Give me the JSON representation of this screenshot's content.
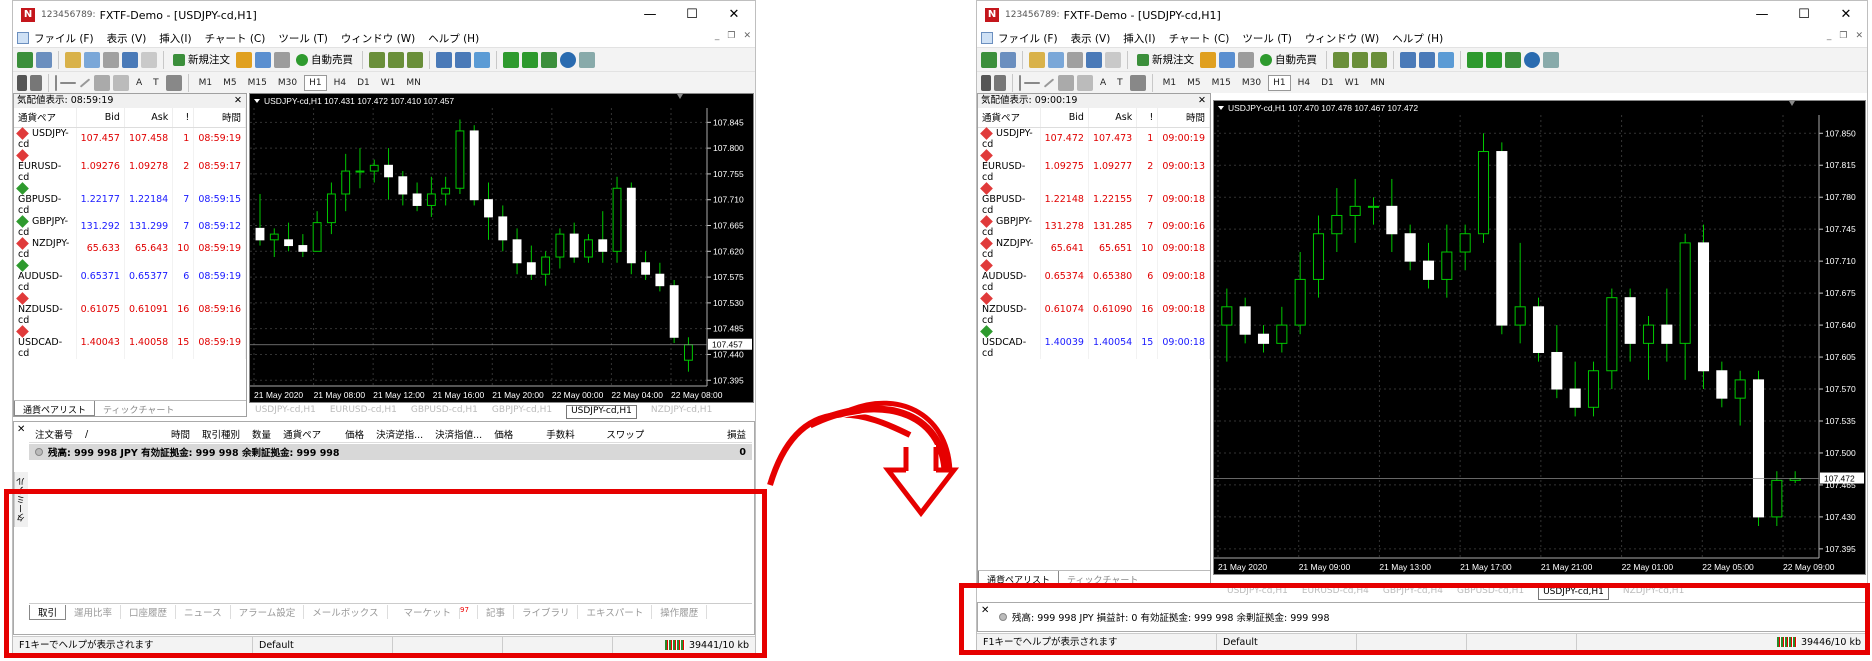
{
  "left": {
    "account": "123456789:",
    "title": "FXTF-Demo - [USDJPY-cd,H1]",
    "menus": [
      "ファイル (F)",
      "表示 (V)",
      "挿入(I)",
      "チャート (C)",
      "ツール (T)",
      "ウィンドウ (W)",
      "ヘルプ (H)"
    ],
    "toolbar": {
      "new_order": "新規注文",
      "auto_trade": "自動売買"
    },
    "timeframes": [
      "M1",
      "M5",
      "M15",
      "M30",
      "H1",
      "H4",
      "D1",
      "W1",
      "MN"
    ],
    "active_timeframe": "H1",
    "market_watch": {
      "title": "気配値表示: 08:59:19",
      "headers": [
        "通貨ペア",
        "Bid",
        "Ask",
        "!",
        "時間"
      ],
      "rows": [
        {
          "sym": "USDJPY-cd",
          "bid": "107.457",
          "ask": "107.458",
          "spread": "1",
          "time": "08:59:19",
          "dir": "down"
        },
        {
          "sym": "EURUSD-cd",
          "bid": "1.09276",
          "ask": "1.09278",
          "spread": "2",
          "time": "08:59:17",
          "dir": "down"
        },
        {
          "sym": "GBPUSD-cd",
          "bid": "1.22177",
          "ask": "1.22184",
          "spread": "7",
          "time": "08:59:15",
          "dir": "up"
        },
        {
          "sym": "GBPJPY-cd",
          "bid": "131.292",
          "ask": "131.299",
          "spread": "7",
          "time": "08:59:12",
          "dir": "up"
        },
        {
          "sym": "NZDJPY-cd",
          "bid": "65.633",
          "ask": "65.643",
          "spread": "10",
          "time": "08:59:19",
          "dir": "down"
        },
        {
          "sym": "AUDUSD-cd",
          "bid": "0.65371",
          "ask": "0.65377",
          "spread": "6",
          "time": "08:59:19",
          "dir": "up"
        },
        {
          "sym": "NZDUSD-cd",
          "bid": "0.61075",
          "ask": "0.61091",
          "spread": "16",
          "time": "08:59:16",
          "dir": "down"
        },
        {
          "sym": "USDCAD-cd",
          "bid": "1.40043",
          "ask": "1.40058",
          "spread": "15",
          "time": "08:59:19",
          "dir": "down"
        }
      ],
      "tabs": [
        "通貨ペアリスト",
        "ティックチャート"
      ]
    },
    "chart_header": "USDJPY-cd,H1  107.431 107.472 107.410 107.457",
    "price_labels": [
      "107.845",
      "107.800",
      "107.755",
      "107.710",
      "107.665",
      "107.620",
      "107.575",
      "107.530",
      "107.485",
      "107.440",
      "107.395"
    ],
    "current_price": "107.457",
    "time_labels": [
      "21 May 2020",
      "21 May 08:00",
      "21 May 12:00",
      "21 May 16:00",
      "21 May 20:00",
      "22 May 00:00",
      "22 May 04:00",
      "22 May 08:00"
    ],
    "chart_tabs": [
      "USDJPY-cd,H1",
      "EURUSD-cd,H1",
      "GBPUSD-cd,H1",
      "GBPJPY-cd,H1",
      "USDJPY-cd,H1",
      "NZDJPY-cd,H1"
    ],
    "terminal": {
      "side_label": "ターミナル",
      "headers": [
        "注文番号",
        "/",
        "時間",
        "取引種別",
        "数量",
        "通貨ペア",
        "価格",
        "決済逆指...",
        "決済指値...",
        "価格",
        "手数料",
        "スワップ",
        "損益"
      ],
      "balance": "残高: 999 998 JPY  有効証拠金: 999 998  余剰証拠金: 999 998",
      "balance_pl": "0",
      "tabs": [
        "取引",
        "運用比率",
        "口座履歴",
        "ニュース",
        "アラーム設定",
        "メールボックス",
        "マーケット",
        "記事",
        "ライブラリ",
        "エキスパート",
        "操作履歴"
      ],
      "market_badge": "97"
    },
    "status": {
      "help": "F1キーでヘルプが表示されます",
      "profile": "Default",
      "traffic": "39441/10 kb"
    }
  },
  "right": {
    "account": "123456789:",
    "title": "FXTF-Demo - [USDJPY-cd,H1]",
    "menus": [
      "ファイル (F)",
      "表示 (V)",
      "挿入(I)",
      "チャート (C)",
      "ツール (T)",
      "ウィンドウ (W)",
      "ヘルプ (H)"
    ],
    "toolbar": {
      "new_order": "新規注文",
      "auto_trade": "自動売買"
    },
    "timeframes": [
      "M1",
      "M5",
      "M15",
      "M30",
      "H1",
      "H4",
      "D1",
      "W1",
      "MN"
    ],
    "active_timeframe": "H1",
    "market_watch": {
      "title": "気配値表示: 09:00:19",
      "headers": [
        "通貨ペア",
        "Bid",
        "Ask",
        "!",
        "時間"
      ],
      "rows": [
        {
          "sym": "USDJPY-cd",
          "bid": "107.472",
          "ask": "107.473",
          "spread": "1",
          "time": "09:00:19",
          "dir": "down"
        },
        {
          "sym": "EURUSD-cd",
          "bid": "1.09275",
          "ask": "1.09277",
          "spread": "2",
          "time": "09:00:13",
          "dir": "down"
        },
        {
          "sym": "GBPUSD-cd",
          "bid": "1.22148",
          "ask": "1.22155",
          "spread": "7",
          "time": "09:00:18",
          "dir": "down"
        },
        {
          "sym": "GBPJPY-cd",
          "bid": "131.278",
          "ask": "131.285",
          "spread": "7",
          "time": "09:00:16",
          "dir": "down"
        },
        {
          "sym": "NZDJPY-cd",
          "bid": "65.641",
          "ask": "65.651",
          "spread": "10",
          "time": "09:00:18",
          "dir": "down"
        },
        {
          "sym": "AUDUSD-cd",
          "bid": "0.65374",
          "ask": "0.65380",
          "spread": "6",
          "time": "09:00:18",
          "dir": "down"
        },
        {
          "sym": "NZDUSD-cd",
          "bid": "0.61074",
          "ask": "0.61090",
          "spread": "16",
          "time": "09:00:18",
          "dir": "down"
        },
        {
          "sym": "USDCAD-cd",
          "bid": "1.40039",
          "ask": "1.40054",
          "spread": "15",
          "time": "09:00:18",
          "dir": "up"
        }
      ],
      "tabs": [
        "通貨ペアリスト",
        "ティックチャート"
      ]
    },
    "chart_header": "USDJPY-cd,H1  107.470 107.478 107.467 107.472",
    "price_labels": [
      "107.850",
      "107.815",
      "107.780",
      "107.745",
      "107.710",
      "107.675",
      "107.640",
      "107.605",
      "107.570",
      "107.535",
      "107.500",
      "107.465",
      "107.430",
      "107.395"
    ],
    "current_price": "107.472",
    "time_labels": [
      "21 May 2020",
      "21 May 09:00",
      "21 May 13:00",
      "21 May 17:00",
      "21 May 21:00",
      "22 May 01:00",
      "22 May 05:00",
      "22 May 09:00"
    ],
    "chart_tabs": [
      "USDJPY-cd,H1",
      "EURUSD-cd,H4",
      "GBPJPY-cd,H4",
      "GBPUSD-cd,H1",
      "USDJPY-cd,H1",
      "NZDJPY-cd,H1"
    ],
    "terminal": {
      "balance": "残高: 999 998 JPY  損益計: 0  有効証拠金: 999 998  余剰証拠金: 999 998"
    },
    "status": {
      "help": "F1キーでヘルプが表示されます",
      "profile": "Default",
      "traffic": "39446/10 kb"
    }
  },
  "colors": {
    "highlight": "#e60000",
    "bull": "#ffffff",
    "bear": "#00c800",
    "bid_down": "#e00000",
    "bid_up": "#1a1aff"
  },
  "icons": [
    "app-icon",
    "minimize-icon",
    "maximize-icon",
    "close-icon",
    "curved-arrow-icon"
  ],
  "chart_data": [
    {
      "type": "candlestick",
      "title": "USDJPY-cd,H1",
      "ylim": [
        107.385,
        107.87
      ],
      "candles": [
        [
          107.66,
          107.72,
          107.63,
          107.64
        ],
        [
          107.64,
          107.66,
          107.61,
          107.65
        ],
        [
          107.64,
          107.67,
          107.62,
          107.63
        ],
        [
          107.63,
          107.65,
          107.61,
          107.62
        ],
        [
          107.62,
          107.69,
          107.62,
          107.67
        ],
        [
          107.67,
          107.74,
          107.65,
          107.72
        ],
        [
          107.72,
          107.79,
          107.69,
          107.76
        ],
        [
          107.76,
          107.8,
          107.73,
          107.76
        ],
        [
          107.76,
          107.78,
          107.74,
          107.77
        ],
        [
          107.77,
          107.8,
          107.71,
          107.75
        ],
        [
          107.75,
          107.76,
          107.7,
          107.72
        ],
        [
          107.72,
          107.74,
          107.69,
          107.7
        ],
        [
          107.7,
          107.75,
          107.68,
          107.72
        ],
        [
          107.72,
          107.75,
          107.7,
          107.73
        ],
        [
          107.73,
          107.85,
          107.72,
          107.83
        ],
        [
          107.83,
          107.84,
          107.7,
          107.71
        ],
        [
          107.71,
          107.74,
          107.64,
          107.68
        ],
        [
          107.68,
          107.7,
          107.62,
          107.64
        ],
        [
          107.64,
          107.66,
          107.58,
          107.6
        ],
        [
          107.6,
          107.63,
          107.57,
          107.58
        ],
        [
          107.58,
          107.62,
          107.56,
          107.61
        ],
        [
          107.61,
          107.66,
          107.59,
          107.65
        ],
        [
          107.65,
          107.67,
          107.6,
          107.61
        ],
        [
          107.61,
          107.65,
          107.6,
          107.64
        ],
        [
          107.64,
          107.69,
          107.6,
          107.62
        ],
        [
          107.62,
          107.75,
          107.6,
          107.73
        ],
        [
          107.73,
          107.74,
          107.58,
          107.6
        ],
        [
          107.6,
          107.62,
          107.57,
          107.58
        ],
        [
          107.58,
          107.6,
          107.55,
          107.56
        ],
        [
          107.56,
          107.57,
          107.46,
          107.47
        ],
        [
          107.43,
          107.47,
          107.41,
          107.457
        ]
      ]
    },
    {
      "type": "candlestick",
      "title": "USDJPY-cd,H1",
      "ylim": [
        107.385,
        107.87
      ],
      "candles": [
        [
          107.64,
          107.68,
          107.6,
          107.66
        ],
        [
          107.66,
          107.67,
          107.62,
          107.63
        ],
        [
          107.63,
          107.64,
          107.61,
          107.62
        ],
        [
          107.62,
          107.66,
          107.61,
          107.64
        ],
        [
          107.64,
          107.72,
          107.63,
          107.69
        ],
        [
          107.69,
          107.76,
          107.67,
          107.74
        ],
        [
          107.74,
          107.79,
          107.72,
          107.76
        ],
        [
          107.76,
          107.8,
          107.73,
          107.77
        ],
        [
          107.77,
          107.78,
          107.75,
          107.77
        ],
        [
          107.77,
          107.8,
          107.72,
          107.74
        ],
        [
          107.74,
          107.75,
          107.7,
          107.71
        ],
        [
          107.71,
          107.73,
          107.68,
          107.69
        ],
        [
          107.69,
          107.75,
          107.67,
          107.72
        ],
        [
          107.72,
          107.75,
          107.7,
          107.74
        ],
        [
          107.74,
          107.85,
          107.73,
          107.83
        ],
        [
          107.83,
          107.84,
          107.63,
          107.64
        ],
        [
          107.64,
          107.73,
          107.62,
          107.66
        ],
        [
          107.66,
          107.67,
          107.6,
          107.61
        ],
        [
          107.61,
          107.64,
          107.56,
          107.57
        ],
        [
          107.57,
          107.6,
          107.54,
          107.55
        ],
        [
          107.55,
          107.6,
          107.54,
          107.59
        ],
        [
          107.59,
          107.68,
          107.57,
          107.67
        ],
        [
          107.67,
          107.68,
          107.6,
          107.62
        ],
        [
          107.62,
          107.65,
          107.58,
          107.64
        ],
        [
          107.64,
          107.68,
          107.6,
          107.62
        ],
        [
          107.62,
          107.74,
          107.58,
          107.73
        ],
        [
          107.73,
          107.75,
          107.57,
          107.59
        ],
        [
          107.59,
          107.6,
          107.55,
          107.56
        ],
        [
          107.56,
          107.59,
          107.53,
          107.58
        ],
        [
          107.58,
          107.59,
          107.42,
          107.43
        ],
        [
          107.43,
          107.48,
          107.42,
          107.47
        ],
        [
          107.47,
          107.48,
          107.467,
          107.472
        ]
      ]
    }
  ]
}
